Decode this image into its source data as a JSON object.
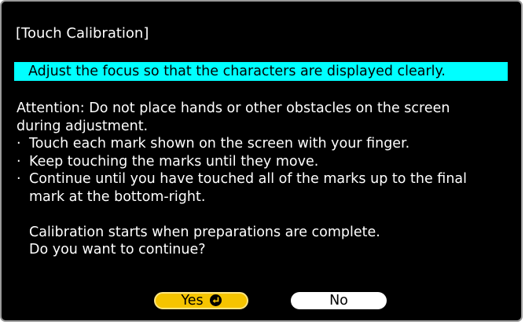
{
  "dialog": {
    "title": "[Touch Calibration]",
    "banner": "Adjust the focus so that the characters are displayed clearly.",
    "attention_lines": [
      "Attention: Do not place hands or other obstacles on the screen",
      "during adjustment."
    ],
    "bullet_marker": "·",
    "bullets": [
      {
        "lines": [
          "Touch each mark shown on the screen with your finger."
        ]
      },
      {
        "lines": [
          "Keep touching the marks until they move."
        ]
      },
      {
        "lines": [
          "Continue until you have touched all of the marks up to the final",
          "mark at the bottom-right."
        ]
      }
    ],
    "prompt_lines": [
      "Calibration starts when preparations are complete.",
      "Do you want to continue?"
    ],
    "buttons": {
      "yes_label": "Yes",
      "yes_icon": "enter-icon",
      "no_label": "No"
    }
  },
  "colors": {
    "background": "#000000",
    "banner": "#00ffff",
    "yes_button": "#f5c400",
    "no_button": "#ffffff",
    "text": "#ffffff"
  }
}
